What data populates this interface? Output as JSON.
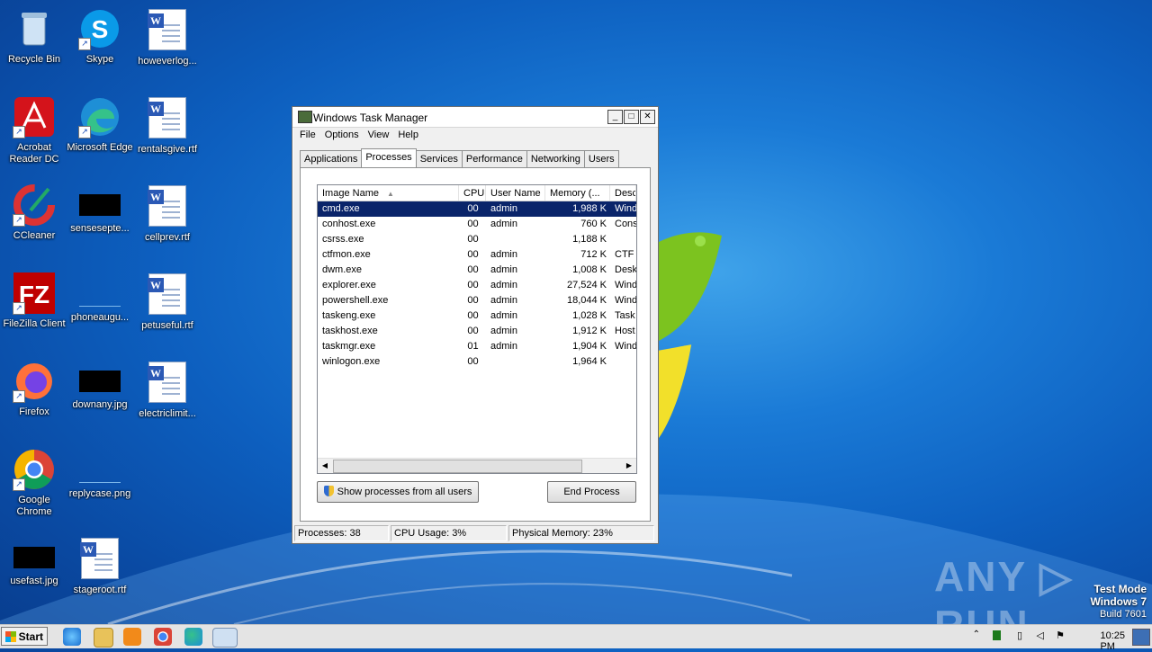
{
  "desktop_icons": [
    {
      "label": "Recycle Bin",
      "icon": "recycle-bin-icon"
    },
    {
      "label": "Skype",
      "icon": "skype-icon"
    },
    {
      "label": "howeverlog...",
      "icon": "word-document-icon"
    },
    {
      "label": "Acrobat Reader DC",
      "label_l1": "Acrobat",
      "label_l2": "Reader DC",
      "icon": "acrobat-icon"
    },
    {
      "label": "Microsoft Edge",
      "icon": "edge-icon"
    },
    {
      "label": "rentalsgive.rtf",
      "icon": "word-document-icon"
    },
    {
      "label": "CCleaner",
      "icon": "ccleaner-icon"
    },
    {
      "label": "sensesepte...",
      "icon": "black-thumbnail-icon"
    },
    {
      "label": "cellprev.rtf",
      "icon": "word-document-icon"
    },
    {
      "label": "FileZilla Client",
      "icon": "filezilla-icon"
    },
    {
      "label": "phoneaugu...",
      "icon": "blank-file-icon"
    },
    {
      "label": "petuseful.rtf",
      "icon": "word-document-icon"
    },
    {
      "label": "Firefox",
      "icon": "firefox-icon"
    },
    {
      "label": "downany.jpg",
      "icon": "black-thumbnail-icon"
    },
    {
      "label": "electriclimit...",
      "icon": "word-document-icon"
    },
    {
      "label": "Google Chrome",
      "label_l1": "Google",
      "label_l2": "Chrome",
      "icon": "chrome-icon"
    },
    {
      "label": "replycase.png",
      "icon": "blank-file-icon"
    },
    {
      "label": "usefast.jpg",
      "icon": "black-thumbnail-icon"
    },
    {
      "label": "stageroot.rtf",
      "icon": "word-document-icon"
    }
  ],
  "window": {
    "title": "Windows Task Manager",
    "menu": [
      "File",
      "Options",
      "View",
      "Help"
    ],
    "tabs": [
      "Applications",
      "Processes",
      "Services",
      "Performance",
      "Networking",
      "Users"
    ],
    "active_tab": "Processes",
    "columns": [
      "Image Name",
      "CPU",
      "User Name",
      "Memory (...",
      "Desc"
    ],
    "processes": [
      {
        "name": "cmd.exe",
        "cpu": "00",
        "user": "admin",
        "mem": "1,988 K",
        "desc": "Wind",
        "selected": true
      },
      {
        "name": "conhost.exe",
        "cpu": "00",
        "user": "admin",
        "mem": "760 K",
        "desc": "Cons"
      },
      {
        "name": "csrss.exe",
        "cpu": "00",
        "user": "",
        "mem": "1,188 K",
        "desc": ""
      },
      {
        "name": "ctfmon.exe",
        "cpu": "00",
        "user": "admin",
        "mem": "712 K",
        "desc": "CTF I"
      },
      {
        "name": "dwm.exe",
        "cpu": "00",
        "user": "admin",
        "mem": "1,008 K",
        "desc": "Desk"
      },
      {
        "name": "explorer.exe",
        "cpu": "00",
        "user": "admin",
        "mem": "27,524 K",
        "desc": "Wind"
      },
      {
        "name": "powershell.exe",
        "cpu": "00",
        "user": "admin",
        "mem": "18,044 K",
        "desc": "Wind"
      },
      {
        "name": "taskeng.exe",
        "cpu": "00",
        "user": "admin",
        "mem": "1,028 K",
        "desc": "Task"
      },
      {
        "name": "taskhost.exe",
        "cpu": "00",
        "user": "admin",
        "mem": "1,912 K",
        "desc": "Host"
      },
      {
        "name": "taskmgr.exe",
        "cpu": "01",
        "user": "admin",
        "mem": "1,904 K",
        "desc": "Wind"
      },
      {
        "name": "winlogon.exe",
        "cpu": "00",
        "user": "",
        "mem": "1,964 K",
        "desc": ""
      }
    ],
    "show_all_button": "Show processes from all users",
    "end_process_button": "End Process",
    "status": {
      "processes": "Processes: 38",
      "cpu": "CPU Usage: 3%",
      "memory": "Physical Memory: 23%"
    }
  },
  "watermark": {
    "brand": "ANY ▷ RUN",
    "test_mode": "Test Mode",
    "os": "Windows 7",
    "build": "Build 7601"
  },
  "taskbar": {
    "start_label": "Start",
    "pinned": [
      "internet-explorer-icon",
      "explorer-folder-icon",
      "media-player-icon",
      "chrome-icon",
      "edge-icon",
      "task-manager-icon"
    ],
    "clock": "10:25 PM"
  }
}
